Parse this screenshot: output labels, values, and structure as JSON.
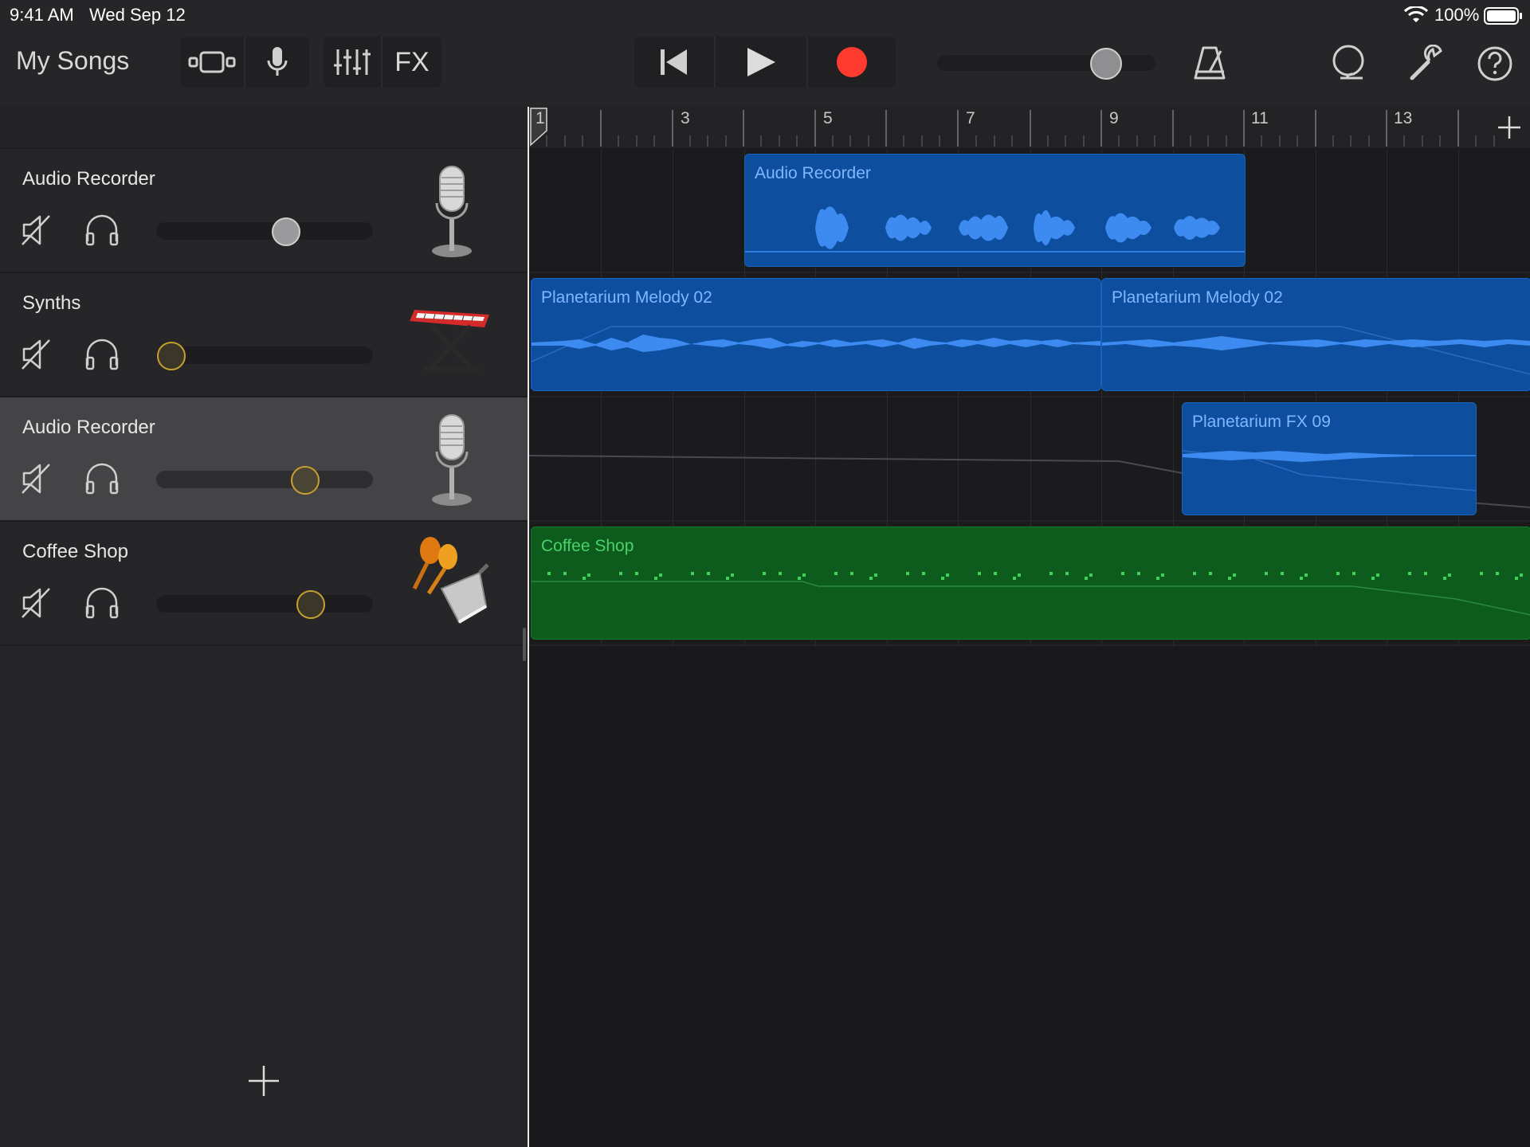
{
  "status_bar": {
    "time": "9:41 AM",
    "date": "Wed Sep 12",
    "battery": "100%"
  },
  "toolbar": {
    "my_songs_label": "My Songs",
    "fx_label": "FX",
    "record_color": "#ff3b30"
  },
  "ruler": {
    "bar_numbers": [
      "1",
      "3",
      "5",
      "7",
      "9",
      "11",
      "13"
    ]
  },
  "tracks": [
    {
      "name": "Audio Recorder",
      "instrument_icon": "microphone-icon",
      "selected": false,
      "volume": 0.6
    },
    {
      "name": "Synths",
      "instrument_icon": "keyboard-icon",
      "selected": false,
      "volume": 0.0
    },
    {
      "name": "Audio Recorder",
      "instrument_icon": "microphone-icon",
      "selected": true,
      "volume": 0.68
    },
    {
      "name": "Coffee Shop",
      "instrument_icon": "percussion-icon",
      "selected": false,
      "volume": 0.7
    }
  ],
  "regions": [
    {
      "name": "Audio Recorder",
      "track": 0,
      "color": "blue"
    },
    {
      "name": "Planetarium Melody 02",
      "track": 1,
      "color": "blue"
    },
    {
      "name": "Planetarium Melody 02",
      "track": 1,
      "color": "blue"
    },
    {
      "name": "Planetarium FX 09",
      "track": 2,
      "color": "blue"
    },
    {
      "name": "Coffee Shop",
      "track": 3,
      "color": "green"
    }
  ],
  "colors": {
    "region_blue": "#0d4f9e",
    "region_green": "#0d5c1d",
    "waveform_blue": "#3d8bf0",
    "knob_gold": "#c8a030"
  }
}
